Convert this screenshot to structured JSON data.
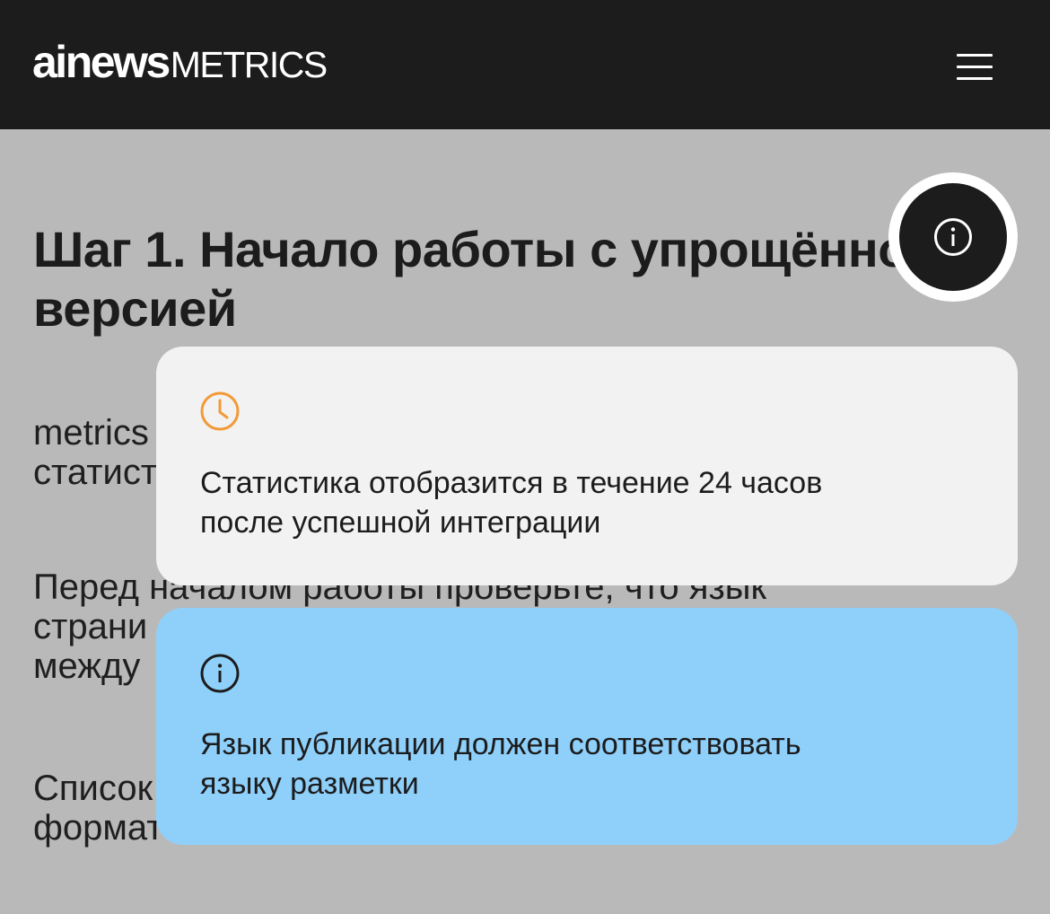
{
  "header": {
    "logo_bold": "ainews",
    "logo_light": "METRICS",
    "menu_icon": "hamburger-menu-icon"
  },
  "article": {
    "heading": "Шаг 1. Начало работы с упрощённой версией",
    "para1": "metrics\nстатист",
    "para2": "Перед началом работы проверьте, что язык\nстрани\nмежду",
    "para3": "Список\nформат"
  },
  "info_button": {
    "icon": "info-icon"
  },
  "cards": {
    "time": {
      "icon": "clock-icon",
      "text": "Статистика отобразится в течение 24 часов\nпосле успешной интеграции"
    },
    "info": {
      "icon": "info-icon",
      "text": "Язык публикации должен соответствовать\nязыку разметки"
    }
  },
  "colors": {
    "header_bg": "#1c1c1c",
    "page_bg": "#b9b9b9",
    "card_time_bg": "#f2f2f2",
    "card_info_bg": "#8fd0fb",
    "clock_accent": "#f29a38"
  }
}
